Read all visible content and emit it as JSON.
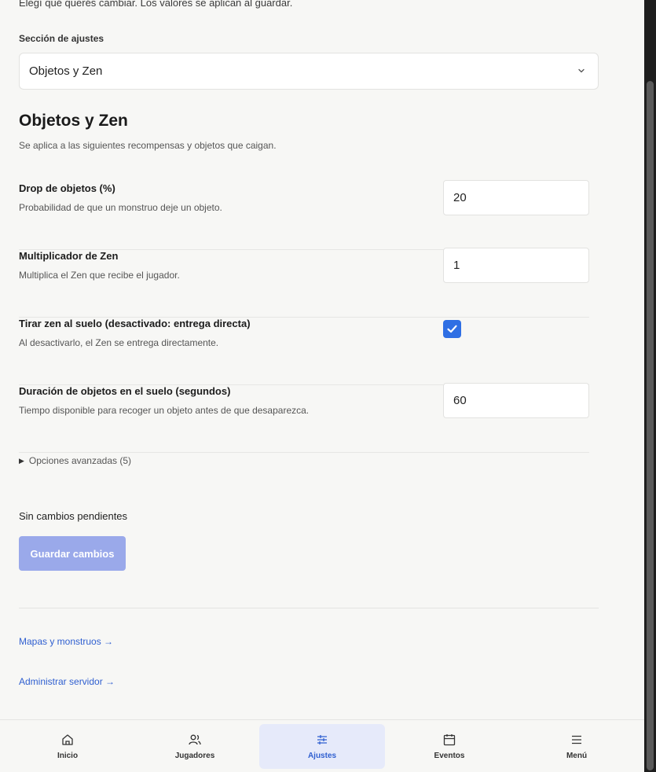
{
  "intro": "Elegí qué querés cambiar. Los valores se aplican al guardar.",
  "section_select": {
    "label": "Sección de ajustes",
    "value": "Objetos y Zen"
  },
  "section": {
    "title": "Objetos y Zen",
    "description": "Se aplica a las siguientes recompensas y objetos que caigan."
  },
  "settings": [
    {
      "label": "Drop de objetos (%)",
      "description": "Probabilidad de que un monstruo deje un objeto.",
      "type": "number",
      "value": "20"
    },
    {
      "label": "Multiplicador de Zen",
      "description": "Multiplica el Zen que recibe el jugador.",
      "type": "number",
      "value": "1"
    },
    {
      "label": "Tirar zen al suelo (desactivado: entrega directa)",
      "description": "Al desactivarlo, el Zen se entrega directamente.",
      "type": "checkbox",
      "checked": true
    },
    {
      "label": "Duración de objetos en el suelo (segundos)",
      "description": "Tiempo disponible para recoger un objeto antes de que desaparezca.",
      "type": "number",
      "value": "60"
    }
  ],
  "advanced": "Opciones avanzadas (5)",
  "status": "Sin cambios pendientes",
  "save_button": "Guardar cambios",
  "links": {
    "maps": "Mapas y monstruos →",
    "server": "Administrar servidor →"
  },
  "nav": [
    {
      "label": "Inicio",
      "icon": "home-icon"
    },
    {
      "label": "Jugadores",
      "icon": "users-icon"
    },
    {
      "label": "Ajustes",
      "icon": "sliders-icon",
      "active": true
    },
    {
      "label": "Eventos",
      "icon": "calendar-icon"
    },
    {
      "label": "Menú",
      "icon": "menu-icon"
    }
  ],
  "colors": {
    "accent": "#2f6fe4",
    "link": "#2f5fd0",
    "button_disabled": "#9aa9ea",
    "nav_active_bg": "#e6eafa"
  }
}
